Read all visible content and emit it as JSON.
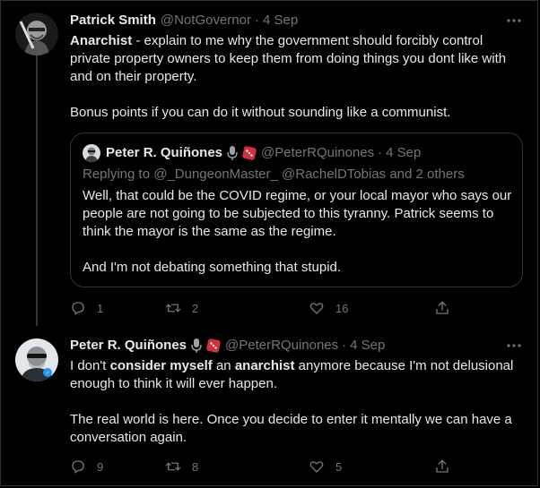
{
  "colors": {
    "background": "#000000",
    "text": "#e7e9ea",
    "muted": "#71767b",
    "border": "#2f3336"
  },
  "tweets": [
    {
      "name": "Patrick Smith",
      "handle": "@NotGovernor",
      "dot": "·",
      "date": "4 Sep",
      "text_prefix": "Anarchist",
      "text_line1_rest": " - explain to me why the government should forcibly control private property owners to keep them from doing things you dont like with and on their property.",
      "text_para2": "Bonus points if you can do it without sounding like a communist.",
      "stats": {
        "replies": "1",
        "retweets": "2",
        "likes": "16"
      },
      "quote": {
        "name": "Peter R. Quiñones",
        "handle": "@PeterRQuinones",
        "dot": "·",
        "date": "4 Sep",
        "reply_prefix": "Replying to",
        "reply_to_1": "@_DungeonMaster_",
        "reply_to_2": "@RachelDTobias",
        "reply_suffix": "and 2 others",
        "para1": "Well, that could be the COVID regime, or your local mayor who says our people are not going to be subjected to this tyranny. Patrick seems to think the mayor is the same as the regime.",
        "para2": "And I'm not debating something that stupid."
      }
    },
    {
      "name": "Peter R. Quiñones",
      "handle": "@PeterRQuinones",
      "dot": "·",
      "date": "4 Sep",
      "t1": "I don't ",
      "t2": "consider myself",
      "t3": " an ",
      "t4": "anarchist",
      "t5": " anymore because I'm not delusional enough to think it will ever happen.",
      "para2": "The real world is here. Once you decide to enter it mentally we can have a conversation again.",
      "stats": {
        "replies": "9",
        "retweets": "8",
        "likes": "5"
      }
    }
  ],
  "icons": [
    "more-icon",
    "reply-icon",
    "retweet-icon",
    "like-icon",
    "share-icon",
    "microphone-icon",
    "dice-icon",
    "verified-badge-icon"
  ]
}
